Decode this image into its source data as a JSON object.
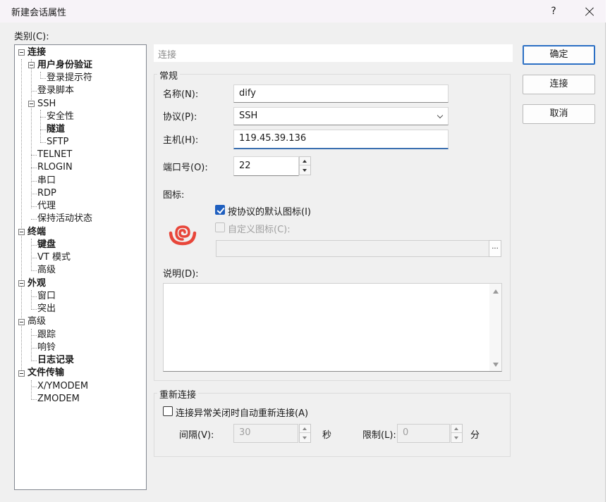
{
  "title": "新建会话属性",
  "title_buttons": {
    "help": "?"
  },
  "category_label": "类别(C):",
  "tree": {
    "items": [
      {
        "label": "连接",
        "bold": true
      },
      {
        "label": "用户身份验证",
        "bold": true
      },
      {
        "label": "登录提示符",
        "bold": false
      },
      {
        "label": "登录脚本",
        "bold": false
      },
      {
        "label": "SSH",
        "bold": false
      },
      {
        "label": "安全性",
        "bold": false
      },
      {
        "label": "隧道",
        "bold": true
      },
      {
        "label": "SFTP",
        "bold": false
      },
      {
        "label": "TELNET",
        "bold": false
      },
      {
        "label": "RLOGIN",
        "bold": false
      },
      {
        "label": "串口",
        "bold": false
      },
      {
        "label": "RDP",
        "bold": false
      },
      {
        "label": "代理",
        "bold": false
      },
      {
        "label": "保持活动状态",
        "bold": false
      },
      {
        "label": "终端",
        "bold": true
      },
      {
        "label": "键盘",
        "bold": true
      },
      {
        "label": "VT 模式",
        "bold": false
      },
      {
        "label": "高级",
        "bold": false
      },
      {
        "label": "外观",
        "bold": true
      },
      {
        "label": "窗口",
        "bold": false
      },
      {
        "label": "突出",
        "bold": false
      },
      {
        "label": "高级",
        "bold": false
      },
      {
        "label": "跟踪",
        "bold": false
      },
      {
        "label": "响铃",
        "bold": false
      },
      {
        "label": "日志记录",
        "bold": true
      },
      {
        "label": "文件传输",
        "bold": true
      },
      {
        "label": "X/YMODEM",
        "bold": false
      },
      {
        "label": "ZMODEM",
        "bold": false
      }
    ]
  },
  "section_header": "连接",
  "general": {
    "group_title": "常规",
    "name_label": "名称(N):",
    "name_value": "dify",
    "protocol_label": "协议(P):",
    "protocol_value": "SSH",
    "host_label": "主机(H):",
    "host_value": "119.45.39.136",
    "port_label": "端口号(O):",
    "port_value": "22",
    "icon_label": "图标:",
    "default_icon_label": "按协议的默认图标(I)",
    "default_icon_checked": true,
    "custom_icon_label": "自定义图标(C):",
    "custom_icon_checked": false,
    "custom_icon_path": "",
    "browse_label": "...",
    "description_label": "说明(D):",
    "description_value": ""
  },
  "reconnect": {
    "group_title": "重新连接",
    "auto_reconnect_label": "连接异常关闭时自动重新连接(A)",
    "auto_reconnect_checked": false,
    "interval_label": "间隔(V):",
    "interval_value": "30",
    "interval_unit": "秒",
    "limit_label": "限制(L):",
    "limit_value": "0",
    "limit_unit": "分"
  },
  "buttons": {
    "ok": "确定",
    "connect": "连接",
    "cancel": "取消"
  },
  "colors": {
    "accent": "#1f5fbf",
    "icon_red": "#e8463a"
  }
}
